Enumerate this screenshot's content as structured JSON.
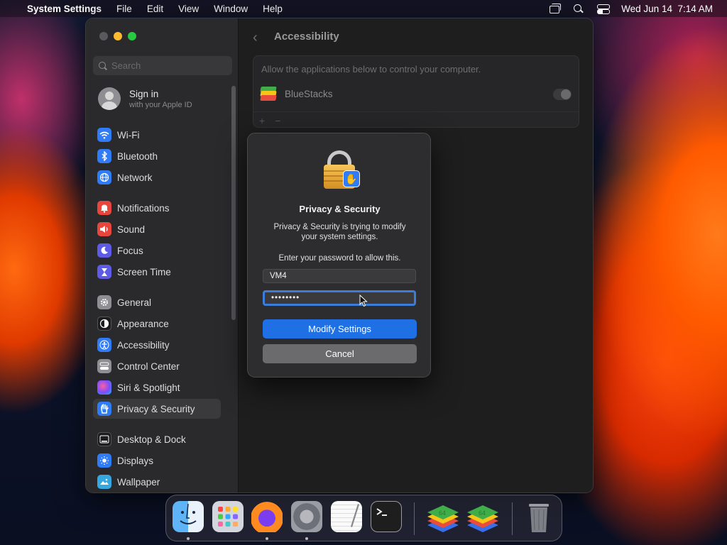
{
  "menubar": {
    "app_name": "System Settings",
    "menus": [
      "File",
      "Edit",
      "View",
      "Window",
      "Help"
    ],
    "clock": "Wed Jun 14  7:14 AM"
  },
  "sidebar": {
    "search_placeholder": "Search",
    "account": {
      "title": "Sign in",
      "subtitle": "with your Apple ID"
    },
    "items": [
      {
        "label": "Wi-Fi",
        "icon": "wifi-icon",
        "color": "#2f7cf6"
      },
      {
        "label": "Bluetooth",
        "icon": "bluetooth-icon",
        "color": "#2f7cf6"
      },
      {
        "label": "Network",
        "icon": "network-globe-icon",
        "color": "#2f7cf6"
      },
      {
        "label": "Notifications",
        "icon": "bell-icon",
        "color": "#e8453c"
      },
      {
        "label": "Sound",
        "icon": "speaker-icon",
        "color": "#e8453c"
      },
      {
        "label": "Focus",
        "icon": "moon-icon",
        "color": "#5e5ce6"
      },
      {
        "label": "Screen Time",
        "icon": "hourglass-icon",
        "color": "#5e5ce6"
      },
      {
        "label": "General",
        "icon": "gear-icon",
        "color": "#8e8e93"
      },
      {
        "label": "Appearance",
        "icon": "appearance-icon",
        "color": "#1c1c1e"
      },
      {
        "label": "Accessibility",
        "icon": "accessibility-icon",
        "color": "#2f7cf6"
      },
      {
        "label": "Control Center",
        "icon": "control-center-icon",
        "color": "#8e8e93"
      },
      {
        "label": "Siri & Spotlight",
        "icon": "siri-icon",
        "color": "#b34fd6"
      },
      {
        "label": "Privacy & Security",
        "icon": "hand-icon",
        "color": "#2f7cf6"
      },
      {
        "label": "Desktop & Dock",
        "icon": "dock-icon",
        "color": "#1c1c1e"
      },
      {
        "label": "Displays",
        "icon": "sun-icon",
        "color": "#2f7cf6"
      },
      {
        "label": "Wallpaper",
        "icon": "wallpaper-icon",
        "color": "#36a8e0"
      }
    ],
    "active_item": "Privacy & Security"
  },
  "main": {
    "title": "Accessibility",
    "panel_description": "Allow the applications below to control your computer.",
    "apps": [
      {
        "name": "BlueStacks",
        "enabled": false
      }
    ],
    "add_symbol": "+",
    "remove_symbol": "−"
  },
  "dialog": {
    "title": "Privacy & Security",
    "message": "Privacy & Security is trying to modify your system settings.",
    "prompt": "Enter your password to allow this.",
    "username": "VM4",
    "password_mask": "••••••••",
    "primary_button": "Modify Settings",
    "secondary_button": "Cancel"
  },
  "dock": {
    "apps": [
      "Finder",
      "Launchpad",
      "Firefox",
      "System Settings",
      "TextEdit",
      "Terminal",
      "BlueStacks",
      "BlueStacks",
      "Trash"
    ],
    "running": [
      "Finder",
      "Firefox",
      "System Settings"
    ]
  },
  "colors": {
    "accent": "#1f6fe5",
    "window_bg": "#1e1e1e",
    "sidebar_bg": "#2a2a2d"
  }
}
